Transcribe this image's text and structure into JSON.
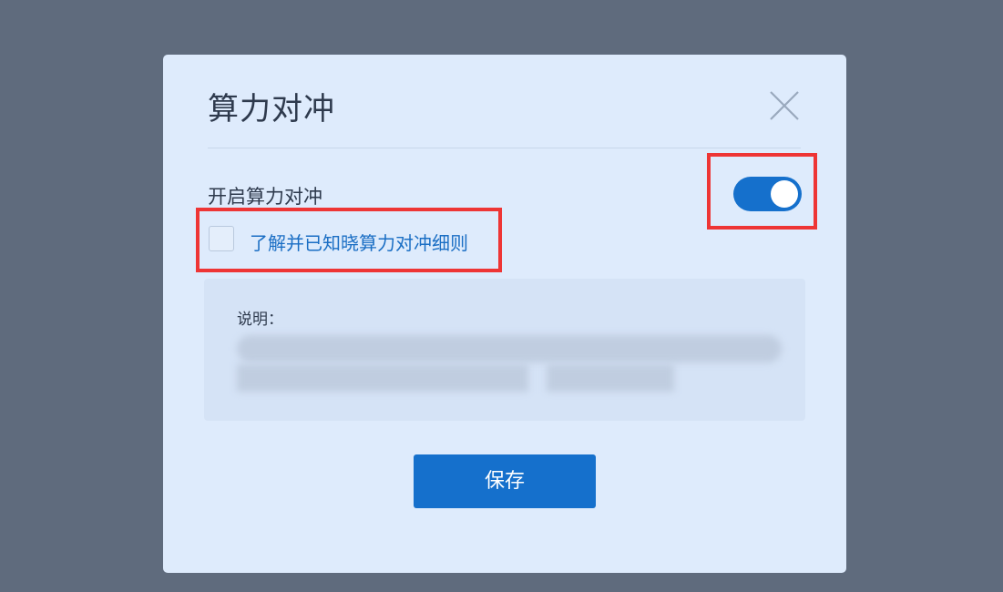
{
  "dialog": {
    "title": "算力对冲",
    "close_icon": "close-icon"
  },
  "toggle_row": {
    "label": "开启算力对冲",
    "toggle_on": true
  },
  "agreement": {
    "checked": false,
    "text": "了解并已知晓算力对冲细则"
  },
  "description": {
    "title": "说明："
  },
  "actions": {
    "save_label": "保存"
  },
  "colors": {
    "overlay": "#5f6b7d",
    "dialog_bg": "#deebfc",
    "primary": "#1570cc",
    "link": "#1a6ec4",
    "highlight": "#ee3535"
  }
}
